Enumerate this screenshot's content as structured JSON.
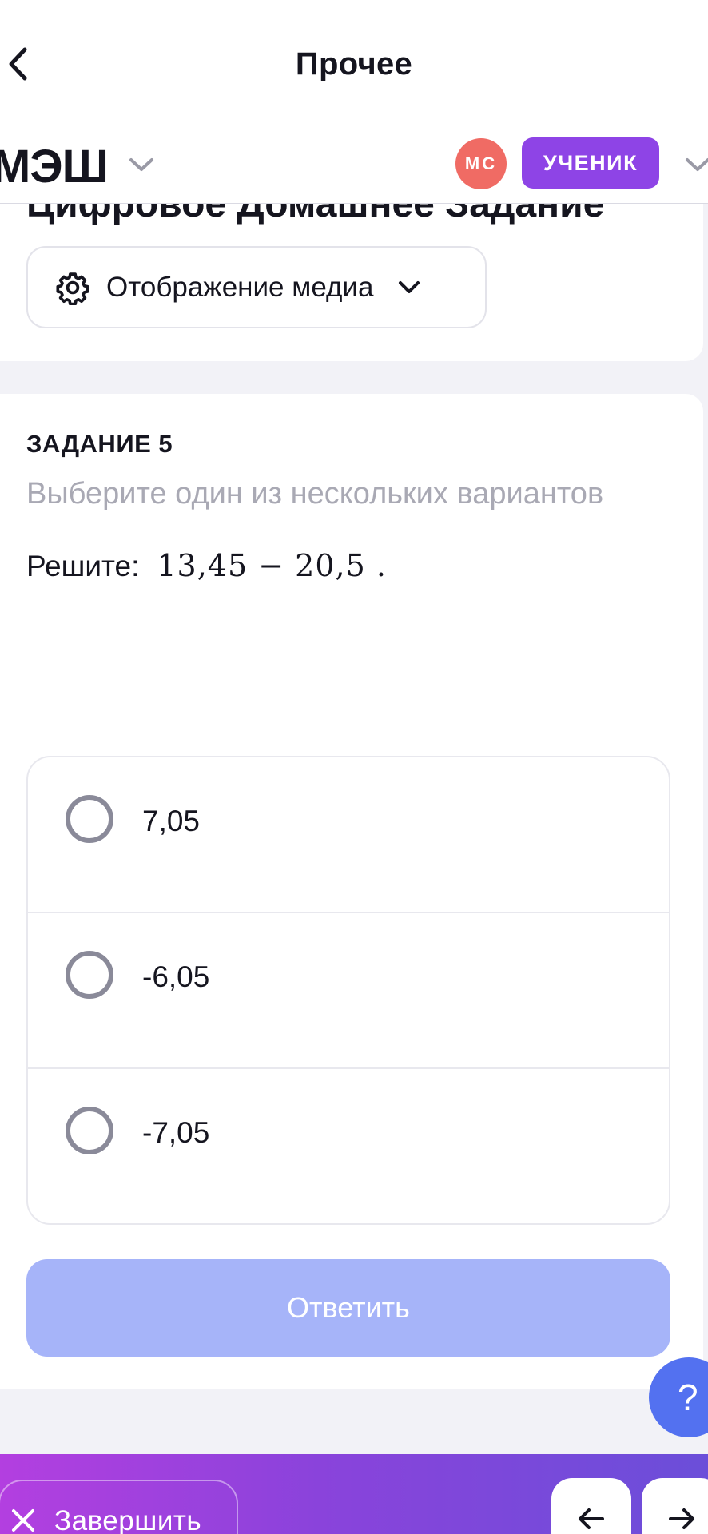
{
  "navbar": {
    "title": "Прочее"
  },
  "header": {
    "logo": "МЭШ",
    "avatar_initials": "МС",
    "role": "УЧЕНИК",
    "avatar_color": "#f06b64",
    "role_color": "#8e44e6"
  },
  "homework": {
    "title": "Цифровое Домашнее Задание",
    "media_button_label": "Отображение медиа"
  },
  "task": {
    "number": "ЗАДАНИЕ 5",
    "hint": "Выберите один из нескольких вариантов",
    "question_prefix": "Решите:",
    "expression": "13,45 − 20,5  .",
    "options": [
      {
        "label": "7,05"
      },
      {
        "label": "-6,05"
      },
      {
        "label": "-7,05"
      }
    ],
    "answer_button": "Ответить",
    "answer_button_color": "#a6b4f9"
  },
  "help": {
    "label": "?"
  },
  "bottom_bar": {
    "finish_label": "Завершить",
    "prev_icon": "arrow-left-icon",
    "next_icon": "arrow-right-icon"
  }
}
